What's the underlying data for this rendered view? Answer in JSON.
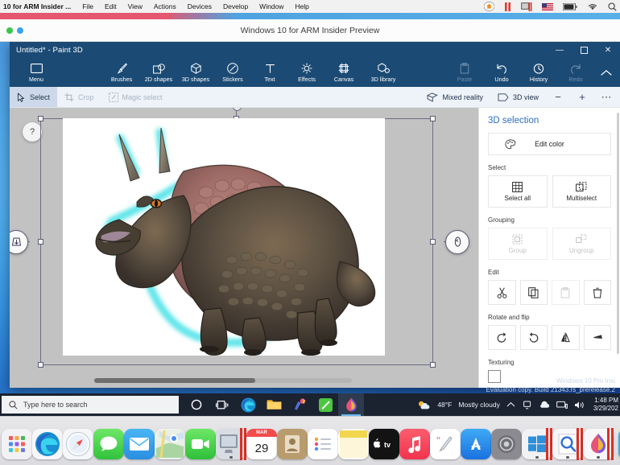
{
  "mac_menubar": {
    "app_name": "10 for ARM Insider ...",
    "menus": [
      "File",
      "Edit",
      "View",
      "Actions",
      "Devices",
      "Develop",
      "Window",
      "Help"
    ],
    "status_icons": [
      "home-icon",
      "pause-icon",
      "vm-icon",
      "us-flag-icon",
      "battery-icon",
      "wifi-icon",
      "spotlight-search-icon"
    ]
  },
  "vm_window": {
    "title": "Windows 10 for ARM Insider Preview",
    "close_dot_color": "#36c84b",
    "minimize_dot_color": "#3aa2e8"
  },
  "paint3d": {
    "title": "Untitled* - Paint 3D",
    "window_buttons": {
      "minimize": "—",
      "maximize": "❐",
      "close": "✕"
    },
    "ribbon": [
      {
        "label": "Menu",
        "icon": "menu-rectangle-icon",
        "dim": false
      },
      {
        "label": "Brushes",
        "icon": "brush-icon",
        "dim": false
      },
      {
        "label": "2D shapes",
        "icon": "2d-shapes-icon",
        "dim": false
      },
      {
        "label": "3D shapes",
        "icon": "3d-cube-icon",
        "dim": false
      },
      {
        "label": "Stickers",
        "icon": "sticker-icon",
        "dim": false
      },
      {
        "label": "Text",
        "icon": "text-icon",
        "dim": false
      },
      {
        "label": "Effects",
        "icon": "effects-sun-icon",
        "dim": false
      },
      {
        "label": "Canvas",
        "icon": "canvas-frame-icon",
        "dim": false
      },
      {
        "label": "3D library",
        "icon": "3d-library-icon",
        "dim": false
      }
    ],
    "ribbon_right": [
      {
        "label": "Paste",
        "icon": "paste-icon",
        "dim": true
      },
      {
        "label": "Undo",
        "icon": "undo-icon",
        "dim": false
      },
      {
        "label": "History",
        "icon": "history-clock-icon",
        "dim": false
      },
      {
        "label": "Redo",
        "icon": "redo-icon",
        "dim": true
      }
    ],
    "collapse_icon": "chevron-up-icon",
    "subtoolbar": {
      "left": [
        {
          "label": "Select",
          "icon": "cursor-select-icon",
          "state": "active"
        },
        {
          "label": "Crop",
          "icon": "crop-icon",
          "state": "disabled"
        },
        {
          "label": "Magic select",
          "icon": "magic-select-icon",
          "state": "disabled"
        }
      ],
      "right": [
        {
          "label": "Mixed reality",
          "icon": "mixed-reality-icon",
          "state": "normal"
        },
        {
          "label": "3D view",
          "icon": "3d-view-icon",
          "state": "normal"
        }
      ],
      "zoom_out": "−",
      "zoom_in": "+",
      "more": "⋯"
    },
    "canvas": {
      "help_label": "?",
      "left_handle_icon": "3d-depth-handle-icon",
      "right_handle_icon": "rotate-handle-icon",
      "content_description": "triceratops-3d-model"
    },
    "panel": {
      "heading": "3D selection",
      "edit_color": {
        "label": "Edit color",
        "icon": "color-palette-icon"
      },
      "sections": [
        {
          "label": "Select",
          "buttons": [
            {
              "label": "Select all",
              "icon": "select-all-icon",
              "dim": false
            },
            {
              "label": "Multiselect",
              "icon": "multiselect-icon",
              "dim": false
            }
          ]
        },
        {
          "label": "Grouping",
          "buttons": [
            {
              "label": "Group",
              "icon": "group-icon",
              "dim": true
            },
            {
              "label": "Ungroup",
              "icon": "ungroup-icon",
              "dim": true
            }
          ]
        }
      ],
      "edit_label": "Edit",
      "edit_buttons": [
        {
          "name": "cut-button",
          "icon": "scissors-icon",
          "dim": false
        },
        {
          "name": "copy-button",
          "icon": "copy-icon",
          "dim": false
        },
        {
          "name": "paste-button",
          "icon": "paste-icon",
          "dim": true
        },
        {
          "name": "delete-button",
          "icon": "trash-icon",
          "dim": false
        }
      ],
      "rotate_label": "Rotate and flip",
      "rotate_buttons": [
        {
          "name": "rotate-left-button",
          "icon": "rotate-left-icon"
        },
        {
          "name": "rotate-right-button",
          "icon": "rotate-right-icon"
        },
        {
          "name": "flip-horizontal-button",
          "icon": "flip-horizontal-icon"
        },
        {
          "name": "flip-vertical-button",
          "icon": "flip-vertical-icon"
        }
      ],
      "texturing_label": "Texturing",
      "accent_color": "#2d6fc4"
    }
  },
  "watermark": {
    "line1": "Windows 10 Pro Insi",
    "line2": "Evaluation copy. Build 21343.rs_prerelease.2"
  },
  "taskbar": {
    "search_placeholder": "Type here to search",
    "search_icon": "search-icon",
    "icons": [
      {
        "name": "cortana-icon",
        "active": false
      },
      {
        "name": "task-view-icon",
        "active": false
      },
      {
        "name": "edge-icon",
        "active": false
      },
      {
        "name": "file-explorer-icon",
        "active": false
      },
      {
        "name": "paint3d-taskbar-icon",
        "active": false
      },
      {
        "name": "green-app-icon",
        "active": false
      },
      {
        "name": "paint3d-active-icon",
        "active": true
      }
    ],
    "weather": {
      "icon": "partly-cloudy-icon",
      "temperature": "48°F",
      "condition": "Mostly cloudy"
    },
    "tray_icons": [
      "chevron-up-icon",
      "onedrive-icon",
      "cloud-icon",
      "network-icon",
      "volume-icon"
    ],
    "clock": {
      "time": "1:48 PM",
      "date": "3/29/202"
    }
  },
  "dock": {
    "items": [
      {
        "name": "launchpad",
        "icon": "launchpad-icon",
        "running": false
      },
      {
        "name": "microsoft-edge",
        "icon": "edge-icon",
        "running": false
      },
      {
        "name": "safari",
        "icon": "safari-icon",
        "running": false
      },
      {
        "name": "messages",
        "icon": "messages-icon",
        "running": false
      },
      {
        "name": "mail",
        "icon": "mail-icon",
        "running": false
      },
      {
        "name": "maps",
        "icon": "maps-icon",
        "running": false
      },
      {
        "name": "facetime",
        "icon": "facetime-icon",
        "running": false
      },
      {
        "name": "parallels-desktop",
        "icon": "parallels-icon",
        "running": true
      },
      {
        "name": "calendar",
        "icon": "calendar-icon",
        "running": false,
        "month": "MAR",
        "day": "29"
      },
      {
        "name": "contacts",
        "icon": "contacts-icon",
        "running": false
      },
      {
        "name": "reminders",
        "icon": "reminders-icon",
        "running": false
      },
      {
        "name": "notes",
        "icon": "notes-icon",
        "running": false
      },
      {
        "name": "apple-tv",
        "icon": "appletv-icon",
        "running": false
      },
      {
        "name": "music",
        "icon": "music-icon",
        "running": false
      },
      {
        "name": "freeform",
        "icon": "pencil-icon",
        "running": false
      },
      {
        "name": "app-store",
        "icon": "appstore-icon",
        "running": false
      },
      {
        "name": "system-settings",
        "icon": "settings-gear-icon",
        "running": false
      },
      {
        "name": "windows-10-vm",
        "icon": "windows-logo-icon",
        "running": true
      },
      {
        "name": "preview",
        "icon": "preview-magnifier-icon",
        "running": true
      },
      {
        "name": "paint-3d-vm",
        "icon": "paint3d-icon",
        "running": true
      },
      {
        "name": "downloads-stack",
        "icon": "downloads-folder-icon",
        "running": false
      }
    ]
  }
}
